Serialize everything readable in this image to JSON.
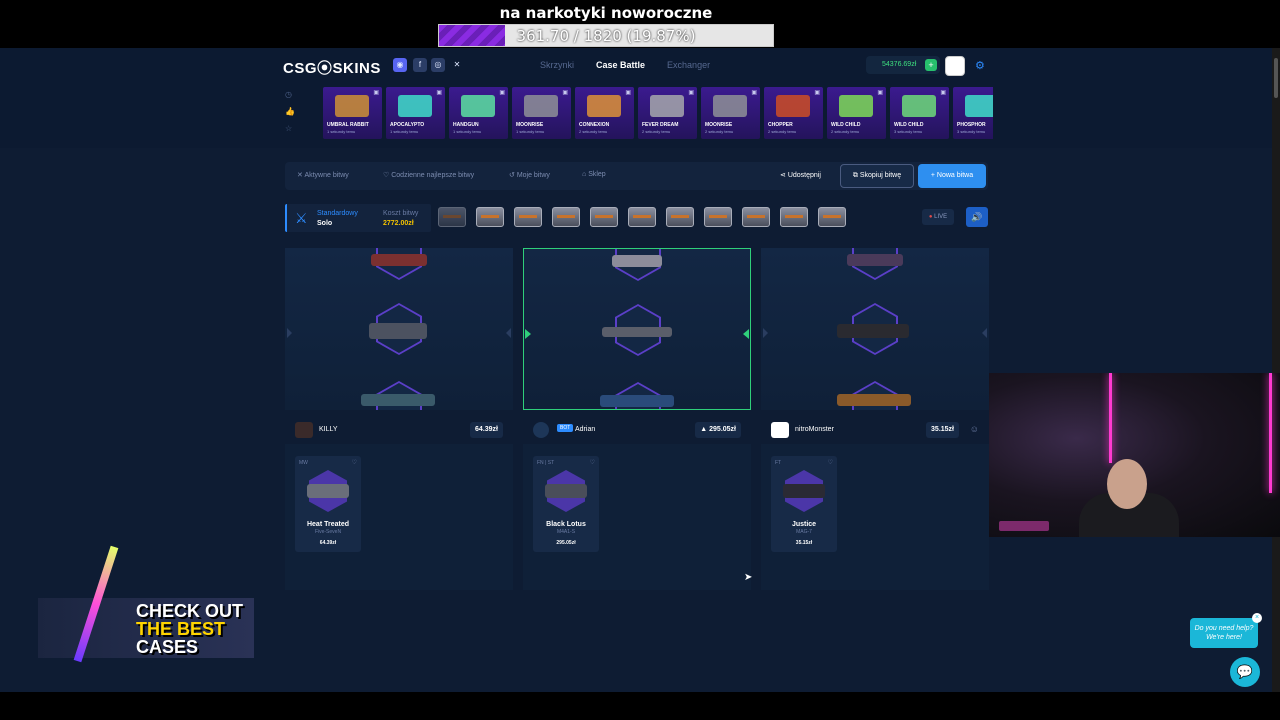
{
  "stream": {
    "goal_title": "na narkotyki noworoczne",
    "goal_text": "361.70 / 1820 (19.87%)",
    "goal_fraction": 0.1987,
    "promo_line1": "CHECK OUT",
    "promo_line2": "THE BEST",
    "promo_line3": "CASES"
  },
  "header": {
    "logo": "CSG⦿SKINS",
    "nav": [
      "Skrzynki",
      "Case Battle",
      "Exchanger"
    ],
    "active_nav": "Case Battle",
    "balance": "54376.69zł"
  },
  "live_drops": [
    {
      "name": "UMBRAL RABBIT",
      "sub": "1 sekundy temu"
    },
    {
      "name": "APOCALYPTO",
      "sub": "1 sekundy temu"
    },
    {
      "name": "HANDGUN",
      "sub": "1 sekundy temu"
    },
    {
      "name": "MOONRISE",
      "sub": "1 sekundy temu"
    },
    {
      "name": "CONNEXION",
      "sub": "2 sekundy temu"
    },
    {
      "name": "FEVER DREAM",
      "sub": "2 sekundy temu"
    },
    {
      "name": "MOONRISE",
      "sub": "2 sekundy temu"
    },
    {
      "name": "CHOPPER",
      "sub": "2 sekundy temu"
    },
    {
      "name": "WILD CHILD",
      "sub": "2 sekundy temu"
    },
    {
      "name": "WILD CHILD",
      "sub": "3 sekundy temu"
    },
    {
      "name": "PHOSPHOR",
      "sub": "3 sekundy temu"
    }
  ],
  "toolbar": {
    "active": "Aktywne bitwy",
    "best": "Codzienne najlepsze bitwy",
    "mine": "Moje bitwy",
    "shop": "Sklep",
    "share": "Udostępnij",
    "copy": "Skopiuj bitwę",
    "new": "+ Nowa bitwa"
  },
  "battle": {
    "mode_label": "Standardowy",
    "mode_value": "Solo",
    "cost_label": "Koszt bitwy",
    "cost_value": "2772.00zł",
    "live": "LIVE"
  },
  "players": [
    {
      "name": "KILLY",
      "value": "64.39zł",
      "item_tag": "MW",
      "item_name": "Heat Treated",
      "item_weapon": "Five-SeveN",
      "item_price": "64.39zł"
    },
    {
      "name": "Adrian",
      "bot": "BOT",
      "value": "▲ 295.05zł",
      "item_tag": "FN | ST",
      "item_name": "Black Lotus",
      "item_weapon": "M4A1-S",
      "item_price": "295.05zł"
    },
    {
      "name": "nitroMonster",
      "value": "35.15zł",
      "item_tag": "FT",
      "item_name": "Justice",
      "item_weapon": "MAG-7",
      "item_price": "35.15zł"
    }
  ],
  "help": {
    "text": "Do you need help? We're here!"
  }
}
